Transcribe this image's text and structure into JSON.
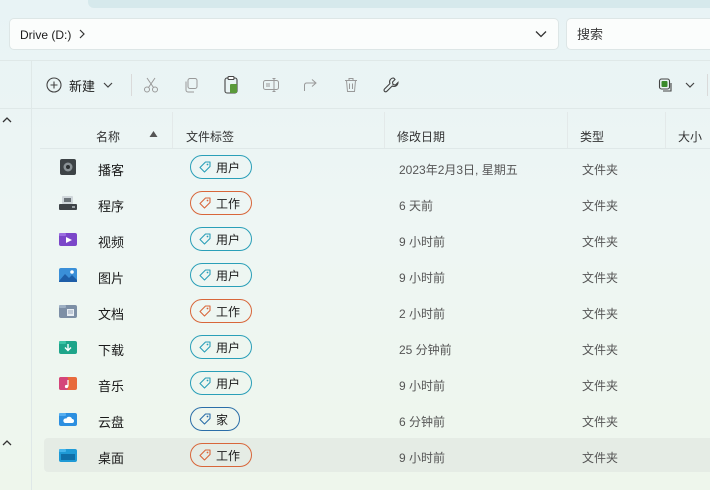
{
  "address": {
    "path": "Drive (D:)"
  },
  "search": {
    "placeholder": "搜索"
  },
  "toolbar": {
    "new_label": "新建"
  },
  "columns": {
    "name": "名称",
    "tags": "文件标签",
    "modified": "修改日期",
    "type": "类型",
    "size": "大小"
  },
  "rows": [
    {
      "name": "播客",
      "tag": "用户",
      "tag_kind": "user",
      "modified": "2023年2月3日, 星期五",
      "type": "文件夹",
      "icon": "podcast-folder-icon"
    },
    {
      "name": "程序",
      "tag": "工作",
      "tag_kind": "work",
      "modified": "6 天前",
      "type": "文件夹",
      "icon": "programs-folder-icon"
    },
    {
      "name": "视频",
      "tag": "用户",
      "tag_kind": "user",
      "modified": "9 小时前",
      "type": "文件夹",
      "icon": "videos-folder-icon"
    },
    {
      "name": "图片",
      "tag": "用户",
      "tag_kind": "user",
      "modified": "9 小时前",
      "type": "文件夹",
      "icon": "pictures-folder-icon"
    },
    {
      "name": "文档",
      "tag": "工作",
      "tag_kind": "work",
      "modified": "2 小时前",
      "type": "文件夹",
      "icon": "documents-folder-icon"
    },
    {
      "name": "下载",
      "tag": "用户",
      "tag_kind": "user",
      "modified": "25 分钟前",
      "type": "文件夹",
      "icon": "downloads-folder-icon"
    },
    {
      "name": "音乐",
      "tag": "用户",
      "tag_kind": "user",
      "modified": "9 小时前",
      "type": "文件夹",
      "icon": "music-folder-icon"
    },
    {
      "name": "云盘",
      "tag": "家",
      "tag_kind": "home",
      "modified": "6 分钟前",
      "type": "文件夹",
      "icon": "cloud-drive-folder-icon"
    },
    {
      "name": "桌面",
      "tag": "工作",
      "tag_kind": "work",
      "modified": "9 小时前",
      "type": "文件夹",
      "icon": "desktop-folder-icon",
      "selected": true
    }
  ],
  "colors": {
    "user_tag": "#2a9fb8",
    "work_tag": "#d8663a",
    "home_tag": "#2b6ea8",
    "selection": "#e5ece5"
  }
}
